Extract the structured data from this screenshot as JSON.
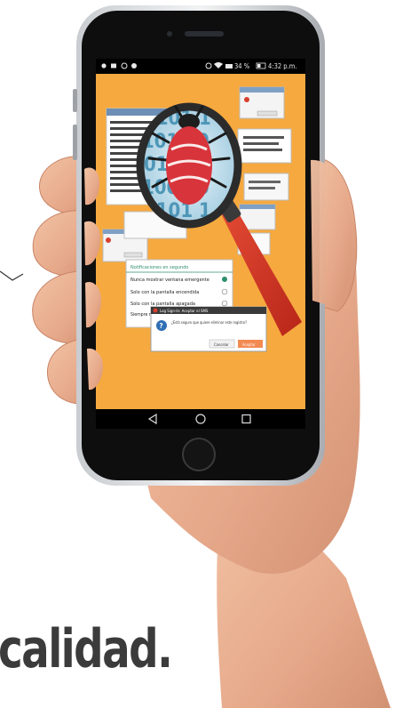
{
  "status_bar": {
    "left_icons": [
      "signal-icon",
      "image-icon",
      "whatsapp-icon",
      "whatsapp-icon"
    ],
    "battery": "34 %",
    "time": "4:32 p.m."
  },
  "illustration": {
    "binary_digits": "0101 1010 0110 1001 1101 0010",
    "colors": {
      "background": "#f6a93f",
      "bug": "#d8343c",
      "handle": "#d23a28",
      "lens_rim": "#2b2b2b"
    }
  },
  "dialog_settings": {
    "title": "Notificaciones en segundo",
    "options": [
      {
        "label": "Nunca mostrar ventana emergente",
        "selected": true
      },
      {
        "label": "Solo con la pantalla encendida",
        "selected": false
      },
      {
        "label": "Solo con la pantalla apagada",
        "selected": false
      },
      {
        "label": "Siempre mostrar ventana emergente",
        "selected": false
      }
    ]
  },
  "dialog_confirm": {
    "title": "Log Sign-In: Aceptar el SMS",
    "message": "¿Está seguro que quiere eliminar este registro?",
    "cancel_label": "Cancelar",
    "accept_label": "Aceptar"
  },
  "nav_bar": {
    "back": "back-icon",
    "home": "home-icon",
    "recents": "recents-icon"
  },
  "caption": "calidad."
}
